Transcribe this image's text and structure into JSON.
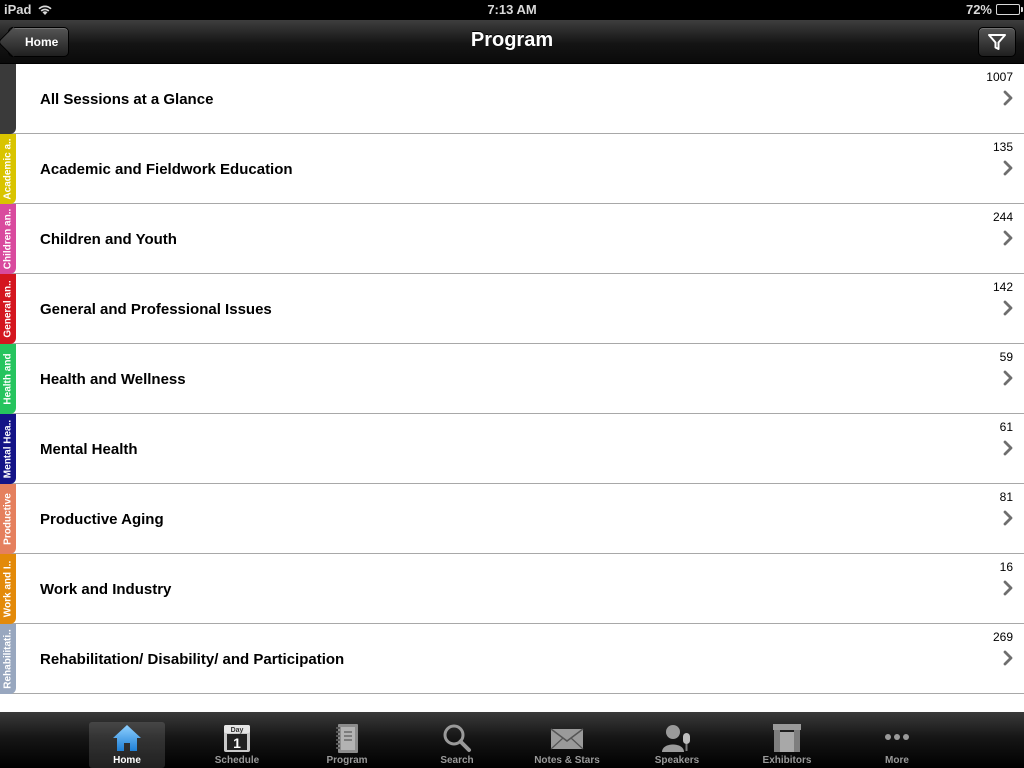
{
  "status_bar": {
    "carrier": "iPad",
    "time": "7:13 AM",
    "battery": "72%",
    "battery_level": 0.72
  },
  "nav": {
    "back_label": "Home",
    "title": "Program"
  },
  "rows": [
    {
      "label": "All Sessions at a Glance",
      "count": "1007",
      "tab_label": "",
      "color": "#3a3a3a"
    },
    {
      "label": "Academic and Fieldwork Education",
      "count": "135",
      "tab_label": "Academic a..",
      "color": "#d9c400"
    },
    {
      "label": "Children and Youth",
      "count": "244",
      "tab_label": "Children an..",
      "color": "#d94a9e"
    },
    {
      "label": "General and Professional Issues",
      "count": "142",
      "tab_label": "General an..",
      "color": "#d4161f"
    },
    {
      "label": "Health and Wellness",
      "count": "59",
      "tab_label": "Health and",
      "color": "#26c45e"
    },
    {
      "label": "Mental Health",
      "count": "61",
      "tab_label": "Mental Hea..",
      "color": "#141487"
    },
    {
      "label": "Productive Aging",
      "count": "81",
      "tab_label": "Productive",
      "color": "#e5805e"
    },
    {
      "label": "Work and Industry",
      "count": "16",
      "tab_label": "Work and I..",
      "color": "#e38a0a"
    },
    {
      "label": "Rehabilitation/ Disability/ and Participation",
      "count": "269",
      "tab_label": "Rehabilitati..",
      "color": "#98a7bf"
    }
  ],
  "tab_bar": {
    "items": [
      {
        "label": "Home",
        "icon": "house-icon",
        "selected": true
      },
      {
        "label": "Schedule",
        "icon": "calendar-icon",
        "calendar_top": "Day",
        "calendar_num": "1"
      },
      {
        "label": "Program",
        "icon": "notebook-icon"
      },
      {
        "label": "Search",
        "icon": "search-icon"
      },
      {
        "label": "Notes & Stars",
        "icon": "envelope-icon"
      },
      {
        "label": "Speakers",
        "icon": "speaker-person-icon"
      },
      {
        "label": "Exhibitors",
        "icon": "booth-icon"
      },
      {
        "label": "More",
        "icon": "more-dots-icon"
      }
    ]
  }
}
